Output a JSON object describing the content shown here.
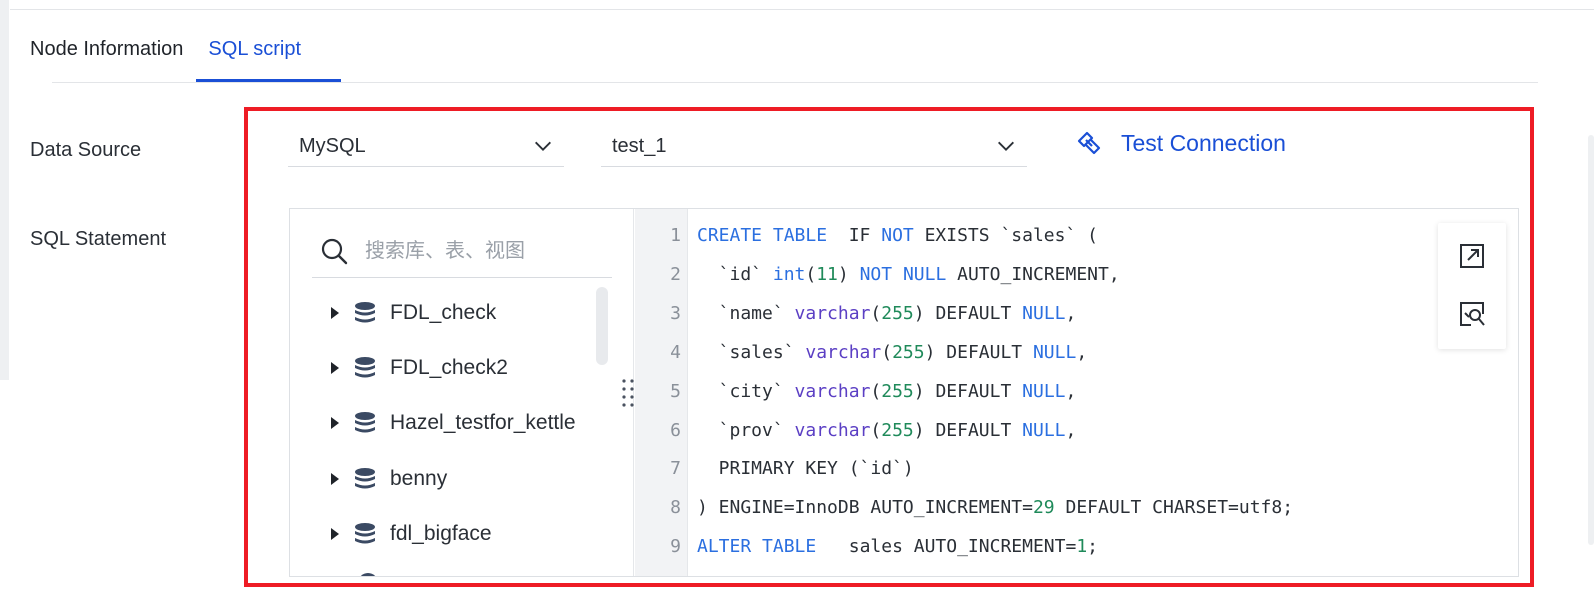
{
  "tabs": [
    {
      "label": "Node Information"
    },
    {
      "label": "SQL script"
    }
  ],
  "active_tab": "SQL script",
  "form": {
    "data_source_label": "Data Source",
    "sql_statement_label": "SQL Statement"
  },
  "datasource": {
    "type_value": "MySQL",
    "connection_value": "test_1",
    "test_connection_label": "Test Connection"
  },
  "tree": {
    "search_placeholder": "搜索库、表、视图",
    "items": [
      {
        "name": "FDL_check"
      },
      {
        "name": "FDL_check2"
      },
      {
        "name": "Hazel_testfor_kettle"
      },
      {
        "name": "benny"
      },
      {
        "name": "fdl_bigface"
      }
    ]
  },
  "editor": {
    "line_numbers": [
      "1",
      "2",
      "3",
      "4",
      "5",
      "6",
      "7",
      "8",
      "9"
    ],
    "lines": [
      [
        {
          "t": "CREATE TABLE",
          "c": "k1"
        },
        {
          "t": "  IF "
        },
        {
          "t": "NOT",
          "c": "k1"
        },
        {
          "t": " EXISTS `sales` ("
        }
      ],
      [
        {
          "t": "  `id` "
        },
        {
          "t": "int",
          "c": "k1"
        },
        {
          "t": "("
        },
        {
          "t": "11",
          "c": "num"
        },
        {
          "t": ") "
        },
        {
          "t": "NOT NULL",
          "c": "k1"
        },
        {
          "t": " AUTO_INCREMENT,"
        }
      ],
      [
        {
          "t": "  `name` "
        },
        {
          "t": "varchar",
          "c": "k2"
        },
        {
          "t": "("
        },
        {
          "t": "255",
          "c": "num"
        },
        {
          "t": ") DEFAULT "
        },
        {
          "t": "NULL",
          "c": "k1"
        },
        {
          "t": ","
        }
      ],
      [
        {
          "t": "  `sales` "
        },
        {
          "t": "varchar",
          "c": "k2"
        },
        {
          "t": "("
        },
        {
          "t": "255",
          "c": "num"
        },
        {
          "t": ") DEFAULT "
        },
        {
          "t": "NULL",
          "c": "k1"
        },
        {
          "t": ","
        }
      ],
      [
        {
          "t": "  `city` "
        },
        {
          "t": "varchar",
          "c": "k2"
        },
        {
          "t": "("
        },
        {
          "t": "255",
          "c": "num"
        },
        {
          "t": ") DEFAULT "
        },
        {
          "t": "NULL",
          "c": "k1"
        },
        {
          "t": ","
        }
      ],
      [
        {
          "t": "  `prov` "
        },
        {
          "t": "varchar",
          "c": "k2"
        },
        {
          "t": "("
        },
        {
          "t": "255",
          "c": "num"
        },
        {
          "t": ") DEFAULT "
        },
        {
          "t": "NULL",
          "c": "k1"
        },
        {
          "t": ","
        }
      ],
      [
        {
          "t": "  PRIMARY KEY (`id`)"
        }
      ],
      [
        {
          "t": ") ENGINE=InnoDB AUTO_INCREMENT="
        },
        {
          "t": "29",
          "c": "num"
        },
        {
          "t": " DEFAULT CHARSET=utf8;"
        }
      ],
      [
        {
          "t": "ALTER TABLE",
          "c": "k1"
        },
        {
          "t": "   sales AUTO_INCREMENT="
        },
        {
          "t": "1",
          "c": "num"
        },
        {
          "t": ";"
        }
      ]
    ]
  },
  "colors": {
    "accent": "#1a4fd6",
    "highlight_frame": "#ee1c25",
    "keyword": "#2b6fe0",
    "type_keyword": "#5b3fc4",
    "number": "#1f8a5a"
  },
  "icons": {
    "test_connection": "link-icon",
    "search": "search-icon",
    "db": "database-icon",
    "expand_editor": "expand-icon",
    "format_sql": "format-icon"
  }
}
